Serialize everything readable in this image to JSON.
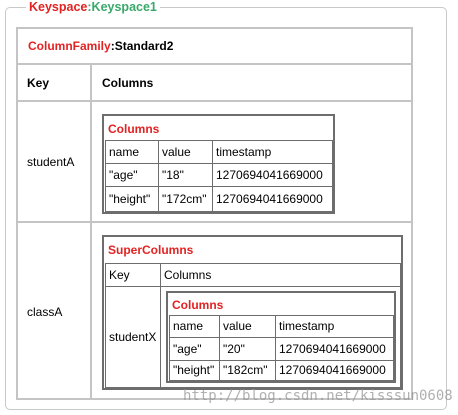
{
  "keyspace": {
    "label": "Keyspace",
    "name": "Keyspace1"
  },
  "column_family": {
    "label": "ColumnFamily",
    "name": "Standard2"
  },
  "headers": {
    "key": "Key",
    "columns": "Columns"
  },
  "rows": [
    {
      "key": "studentA",
      "columns_table": {
        "title": "Columns",
        "headers": [
          "name",
          "value",
          "timestamp"
        ],
        "rows": [
          [
            "\"age\"",
            "\"18\"",
            "1270694041669000"
          ],
          [
            "\"height\"",
            "\"172cm\"",
            "1270694041669000"
          ]
        ]
      }
    },
    {
      "key": "classA",
      "super_columns": {
        "title": "SuperColumns",
        "headers": {
          "key": "Key",
          "columns": "Columns"
        },
        "entry_key": "studentX",
        "columns_table": {
          "title": "Columns",
          "headers": [
            "name",
            "value",
            "timestamp"
          ],
          "rows": [
            [
              "\"age\"",
              "\"20\"",
              "1270694041669000"
            ],
            [
              "\"height\"",
              "\"182cm\"",
              "1270694041669000"
            ]
          ]
        }
      }
    }
  ],
  "watermark": "http://blog.csdn.net/kisssun0608"
}
